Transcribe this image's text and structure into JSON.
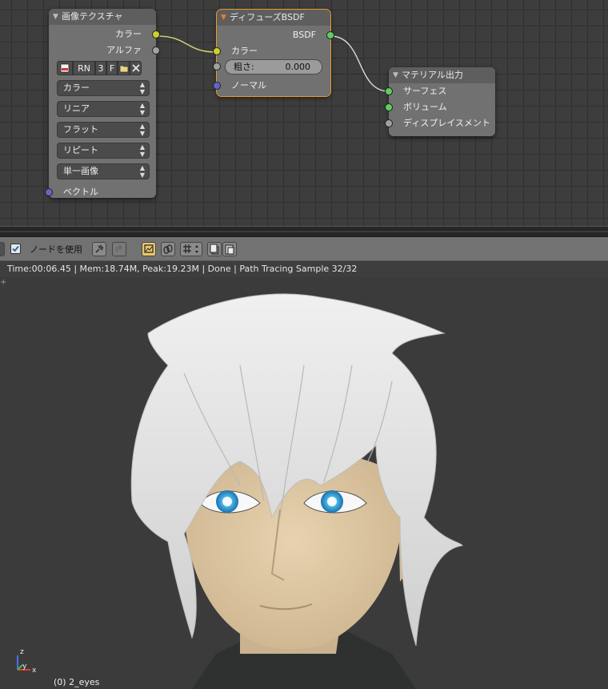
{
  "node_editor": {
    "image_texture_node": {
      "title": "画像テクスチャ",
      "outputs": [
        "カラー",
        "アルファ"
      ],
      "image_buttons": [
        "RN",
        "3",
        "F"
      ],
      "dropdowns": [
        "カラー",
        "リニア",
        "フラット",
        "リピート",
        "単一画像"
      ],
      "input": "ベクトル"
    },
    "diffuse_node": {
      "title": "ディフューズBSDF",
      "output": "BSDF",
      "input_color": "カラー",
      "roughness_label": "粗さ:",
      "roughness_value": "0.000",
      "input_normal": "ノーマル"
    },
    "material_output_node": {
      "title": "マテリアル出力",
      "inputs": [
        "サーフェス",
        "ボリューム",
        "ディスプレイスメント"
      ]
    }
  },
  "toolbar": {
    "use_nodes_label": "ノードを使用",
    "use_nodes_checked": true
  },
  "render_view": {
    "status": "Time:00:06.45 | Mem:18.74M, Peak:19.23M | Done | Path Tracing Sample 32/32",
    "object_label": "(0) 2_eyes",
    "axis_labels": {
      "z": "z",
      "y": "y",
      "x": "x"
    }
  },
  "colors": {
    "socket_yellow": "#cfcf2c",
    "socket_gray": "#a1a1a1",
    "socket_blue": "#6464c8",
    "socket_green": "#5fce5f",
    "selection_orange": "#e89a2f"
  }
}
